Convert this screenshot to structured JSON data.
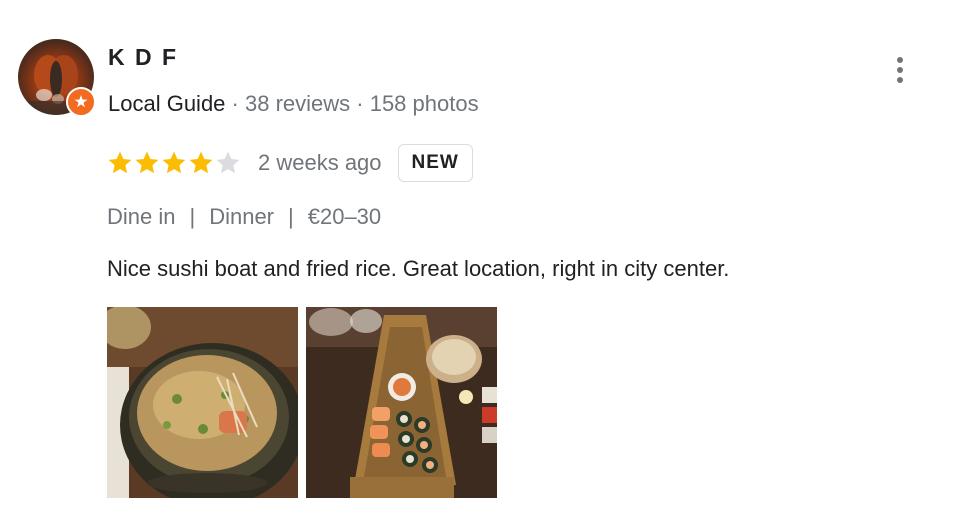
{
  "reviewer": {
    "name": "K D F",
    "level": "Local Guide",
    "separator": " · ",
    "reviews": "38 reviews",
    "photos": "158 photos"
  },
  "rating": {
    "stars": 4,
    "max_stars": 5,
    "filled_color": "#fbbc04",
    "empty_color": "#dadce0"
  },
  "review": {
    "time": "2 weeks ago",
    "badge": "NEW",
    "service": "Dine in",
    "meal": "Dinner",
    "price": "€20–30",
    "pipe": "|",
    "text": "Nice sushi boat and fried rice. Great location, right in city center."
  },
  "photos": [
    {
      "icon": "fried-rice-photo"
    },
    {
      "icon": "sushi-boat-photo"
    }
  ],
  "icons": {
    "menu": "more-vert-icon",
    "badge": "local-guide-badge-icon",
    "badge_color": "#f26b21"
  }
}
